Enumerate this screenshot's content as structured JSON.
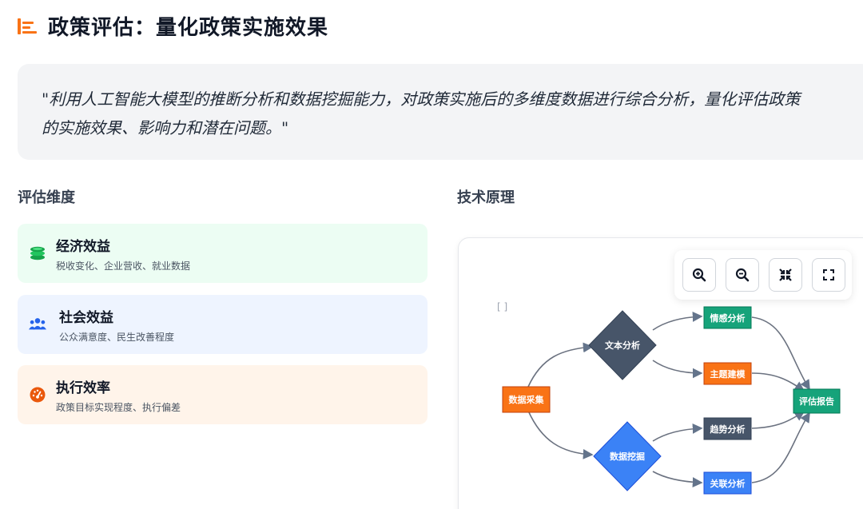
{
  "header": {
    "title": "政策评估：量化政策实施效果",
    "icon": "align-left-icon",
    "accent_color": "#f97316"
  },
  "quote": {
    "line1": "\"利用人工智能大模型的推断分析和数据挖掘能力，对政策实施后的多维度数据进行综合分析，量化评估政策",
    "line2": "的实施效果、影响力和潜在问题。\""
  },
  "dimensions": {
    "heading": "评估维度",
    "items": [
      {
        "title": "经济效益",
        "subtitle": "税收变化、企业营收、就业数据",
        "icon": "coins-icon",
        "bg": "#ecfdf3",
        "color": "#16a34a"
      },
      {
        "title": "社会效益",
        "subtitle": "公众满意度、民生改善程度",
        "icon": "users-icon",
        "bg": "#eef4ff",
        "color": "#2563eb"
      },
      {
        "title": "执行效率",
        "subtitle": "政策目标实现程度、执行偏差",
        "icon": "gauge-icon",
        "bg": "#fff4ea",
        "color": "#ea580c"
      }
    ]
  },
  "tech": {
    "heading": "技术原理",
    "bracket_text": "[ ]",
    "toolbar": [
      {
        "name": "zoom-in-button",
        "icon": "zoom-in-icon"
      },
      {
        "name": "zoom-out-button",
        "icon": "zoom-out-icon"
      },
      {
        "name": "fit-view-button",
        "icon": "compress-icon"
      },
      {
        "name": "fullscreen-button",
        "icon": "expand-icon"
      }
    ]
  },
  "flow": {
    "nodes": {
      "collect": {
        "label": "数据采集",
        "color": "#f97316"
      },
      "text": {
        "label": "文本分析",
        "color": "#475569"
      },
      "mining": {
        "label": "数据挖掘",
        "color": "#3b82f6"
      },
      "sentiment": {
        "label": "情感分析",
        "color": "#16a37a"
      },
      "topic": {
        "label": "主题建模",
        "color": "#f97316"
      },
      "trend": {
        "label": "趋势分析",
        "color": "#475569"
      },
      "assoc": {
        "label": "关联分析",
        "color": "#3b82f6"
      },
      "report": {
        "label": "评估报告",
        "color": "#16a37a"
      }
    }
  }
}
